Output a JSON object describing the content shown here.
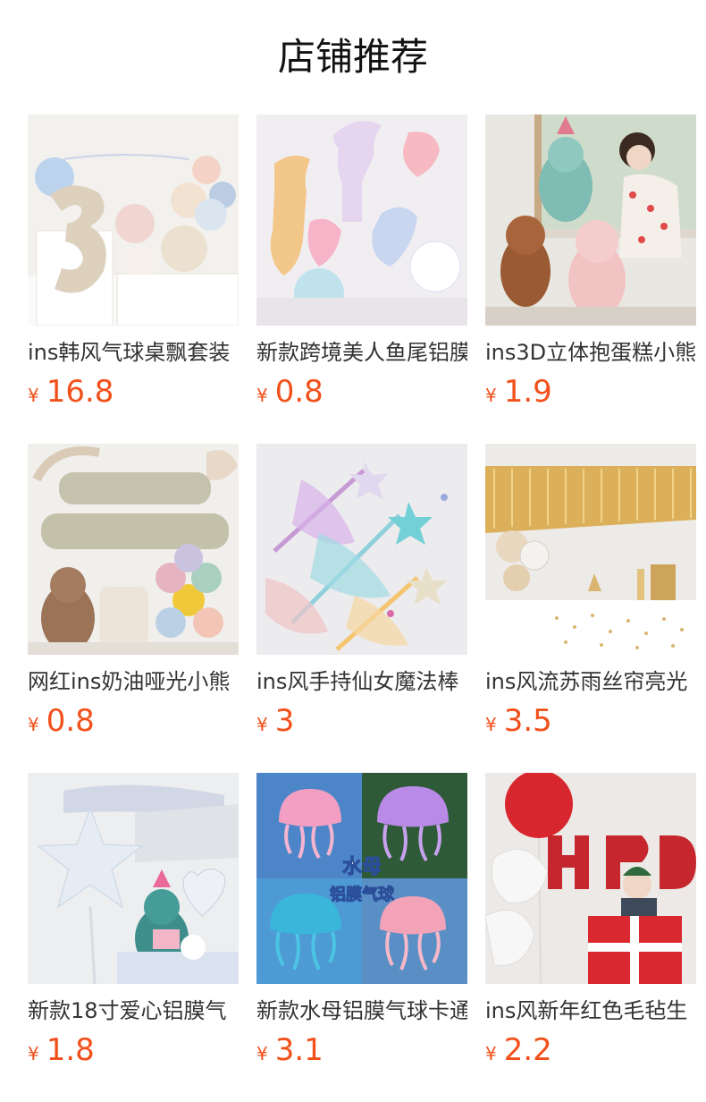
{
  "header": {
    "title": "店铺推荐"
  },
  "currency_symbol": "¥",
  "products": [
    {
      "name": "ins韩风气球桌飘套装",
      "price": "16.8",
      "icon": "balloon-number-3-image"
    },
    {
      "name": "新款跨境美人鱼尾铝膜",
      "price": "0.8",
      "icon": "mermaid-tail-balloon-image"
    },
    {
      "name": "ins3D立体抱蛋糕小熊",
      "price": "1.9",
      "icon": "bear-cake-balloon-image"
    },
    {
      "name": "网红ins奶油哑光小熊",
      "price": "0.8",
      "icon": "happy-birthday-letters-image"
    },
    {
      "name": "ins风手持仙女魔法棒",
      "price": "3",
      "icon": "fairy-wand-image"
    },
    {
      "name": "ins风流苏雨丝帘亮光",
      "price": "3.5",
      "icon": "gold-tinsel-curtain-image"
    },
    {
      "name": "新款18寸爱心铝膜气",
      "price": "1.8",
      "icon": "iridescent-star-heart-balloon-image"
    },
    {
      "name": "新款水母铝膜气球卡通",
      "price": "3.1",
      "icon": "jellyfish-balloon-image",
      "overlay": [
        "水母",
        "铝膜气球"
      ]
    },
    {
      "name": "ins风新年红色毛毡生",
      "price": "2.2",
      "icon": "red-felt-letters-image"
    }
  ],
  "colors": {
    "price": "#f2501a",
    "title": "#111111",
    "name": "#333333"
  }
}
